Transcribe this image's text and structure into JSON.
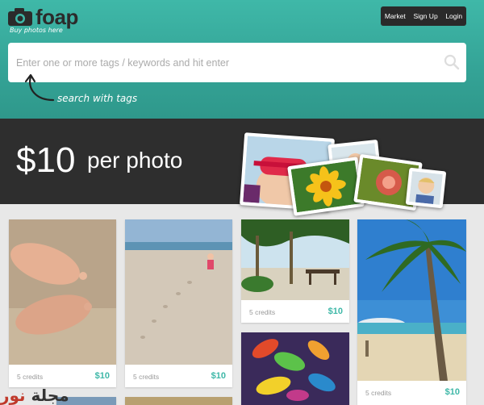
{
  "header": {
    "logo_text": "foap",
    "tagline": "Buy photos here",
    "nav": [
      "Market",
      "Sign Up",
      "Login"
    ]
  },
  "search": {
    "placeholder": "Enter one or more tags / keywords and hit enter",
    "hint": "search with tags"
  },
  "promo": {
    "price": "$10",
    "per": "per photo"
  },
  "photos": [
    {
      "credits": "5 credits",
      "price": "$10"
    },
    {
      "credits": "5 credits",
      "price": "$10"
    },
    {
      "credits": "5 credits",
      "price": "$10"
    },
    {
      "credits": "5 credits",
      "price": "$10"
    }
  ],
  "watermark": {
    "red": "نور",
    "dark": "مجلة"
  },
  "colors": {
    "accent": "#3fb8a8",
    "dark_band": "#2e2e2e",
    "nav_bg": "#2a2a2a"
  }
}
